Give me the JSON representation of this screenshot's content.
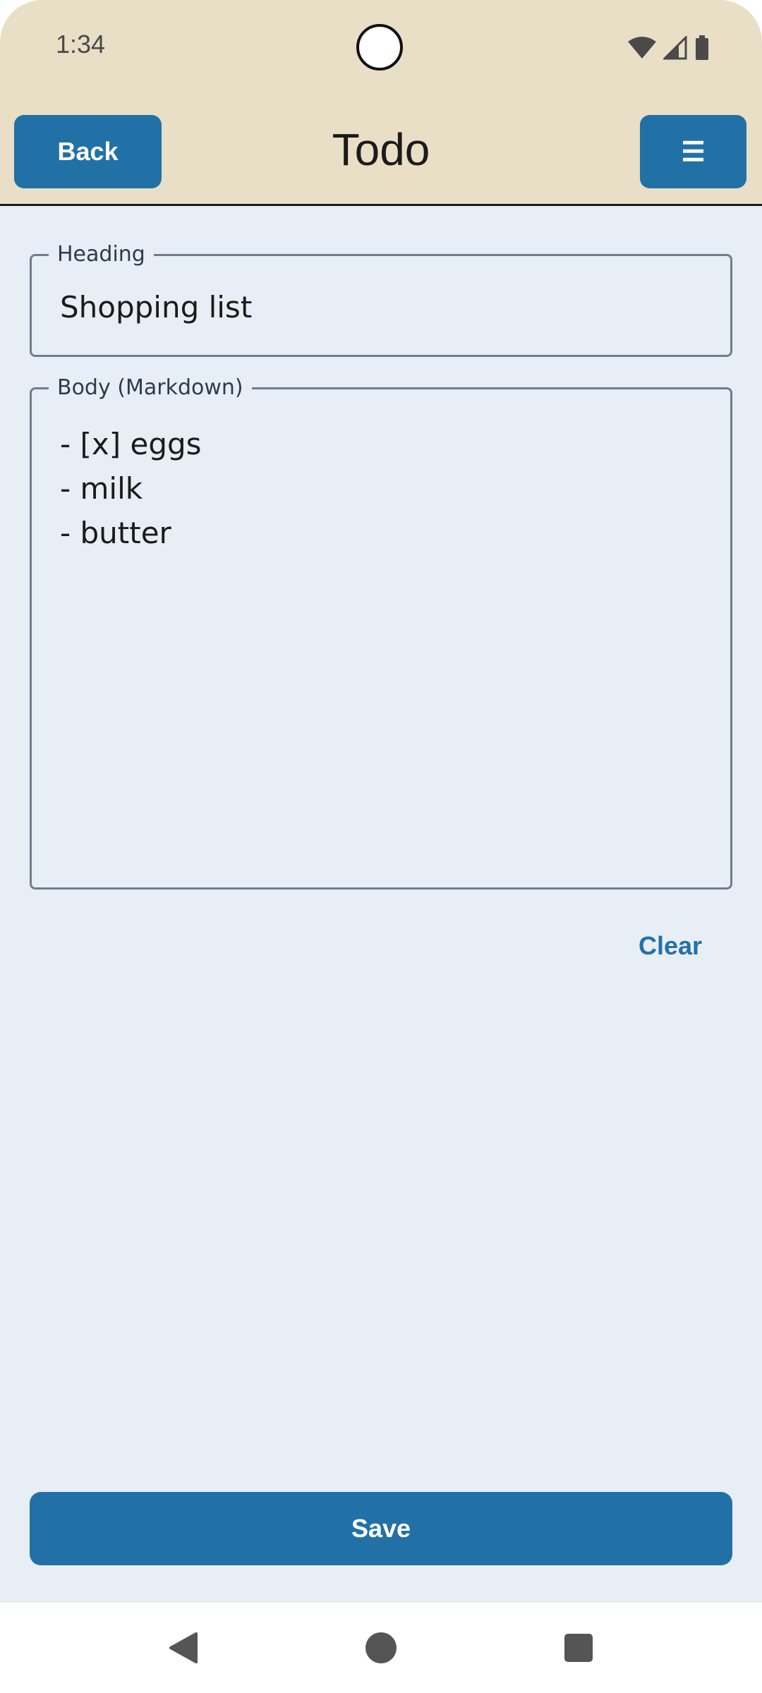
{
  "status_bar": {
    "time": "1:34",
    "icons": [
      "wifi-icon",
      "cellular-signal-icon",
      "battery-icon"
    ]
  },
  "app_bar": {
    "back_label": "Back",
    "title": "Todo",
    "menu_label": "☰"
  },
  "form": {
    "heading": {
      "label": "Heading",
      "value": "Shopping list"
    },
    "body": {
      "label": "Body (Markdown)",
      "lines": [
        "- [x] eggs",
        "- milk",
        "- butter"
      ]
    },
    "clear_label": "Clear",
    "save_label": "Save"
  },
  "nav_bar": {
    "icons": [
      "back-triangle-icon",
      "home-circle-icon",
      "recents-square-icon"
    ]
  },
  "colors": {
    "app_bar_bg": "#e8dfc6",
    "content_bg": "#e8eef5",
    "primary": "#2271a6"
  }
}
